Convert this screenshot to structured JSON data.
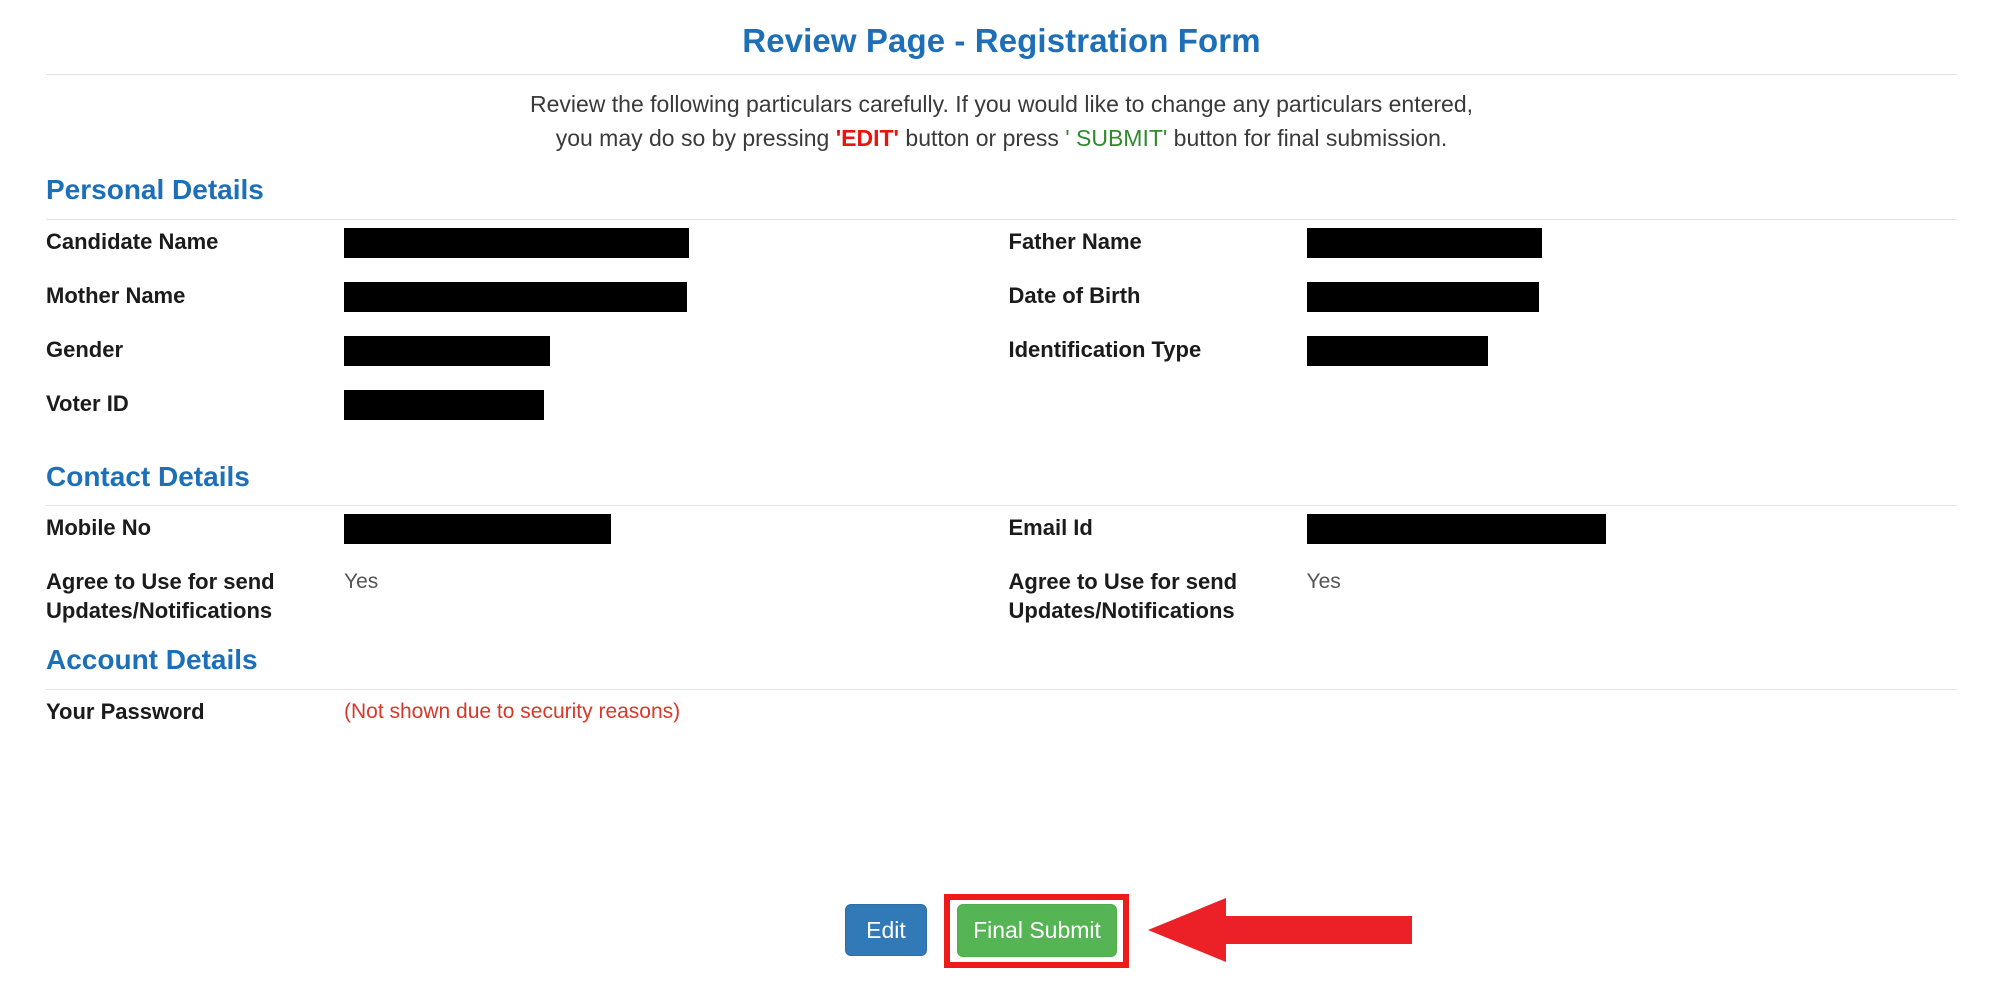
{
  "header": {
    "title": "Review Page - Registration Form",
    "subtitle_line1": "Review the following particulars carefully. If you would like to change any particulars entered,",
    "subtitle_prefix": "you may do so by pressing ",
    "edit_quoted": "'EDIT'",
    "subtitle_middle": " button or press ",
    "submit_quoted": "' SUBMIT'",
    "subtitle_suffix": " button for final submission."
  },
  "colors": {
    "heading_blue": "#1d6fb8",
    "edit_red": "#e8150f",
    "submit_green": "#2e8b2e",
    "password_red": "#d9372b",
    "edit_button_blue": "#3279b7",
    "submit_button_green": "#55b555",
    "highlight_red": "#ee1b1b",
    "arrow_red": "#ec2027",
    "redaction_black": "#000000"
  },
  "sections": [
    {
      "heading": "Personal Details",
      "rows": [
        {
          "left": {
            "label": "Candidate Name",
            "value_type": "redacted",
            "value": "",
            "redaction_width": 345
          },
          "right": {
            "label": "Father Name",
            "value_type": "redacted",
            "value": "",
            "redaction_width": 235
          }
        },
        {
          "left": {
            "label": "Mother Name",
            "value_type": "redacted",
            "value": "",
            "redaction_width": 343
          },
          "right": {
            "label": "Date of Birth",
            "value_type": "redacted",
            "value": "",
            "redaction_width": 232
          }
        },
        {
          "left": {
            "label": "Gender",
            "value_type": "redacted",
            "value": "",
            "redaction_width": 206
          },
          "right": {
            "label": "Identification Type",
            "value_type": "redacted",
            "value": "",
            "redaction_width": 181
          }
        },
        {
          "left": {
            "label": "Voter ID",
            "value_type": "redacted",
            "value": "",
            "redaction_width": 200
          },
          "right": {
            "label": "",
            "value_type": "empty",
            "value": "",
            "redaction_width": 0
          }
        }
      ]
    },
    {
      "heading": "Contact Details",
      "rows": [
        {
          "left": {
            "label": "Mobile No",
            "value_type": "redacted",
            "value": "",
            "redaction_width": 267
          },
          "right": {
            "label": "Email Id",
            "value_type": "redacted",
            "value": "",
            "redaction_width": 299
          }
        },
        {
          "left": {
            "label": "Agree to Use for send Updates/Notifications",
            "value_type": "text",
            "value": "Yes",
            "redaction_width": 0
          },
          "right": {
            "label": "Agree to Use for send Updates/Notifications",
            "value_type": "text",
            "value": "Yes",
            "redaction_width": 0
          }
        }
      ]
    },
    {
      "heading": "Account Details",
      "rows": [
        {
          "left": {
            "label": "Your Password",
            "value_type": "danger",
            "value": "(Not shown due to security reasons)",
            "redaction_width": 0
          },
          "right": {
            "label": "",
            "value_type": "empty",
            "value": "",
            "redaction_width": 0
          }
        }
      ]
    }
  ],
  "footer": {
    "edit_label": "Edit",
    "submit_label": "Final Submit",
    "annotation": "red-arrow-pointing-at-final-submit"
  }
}
